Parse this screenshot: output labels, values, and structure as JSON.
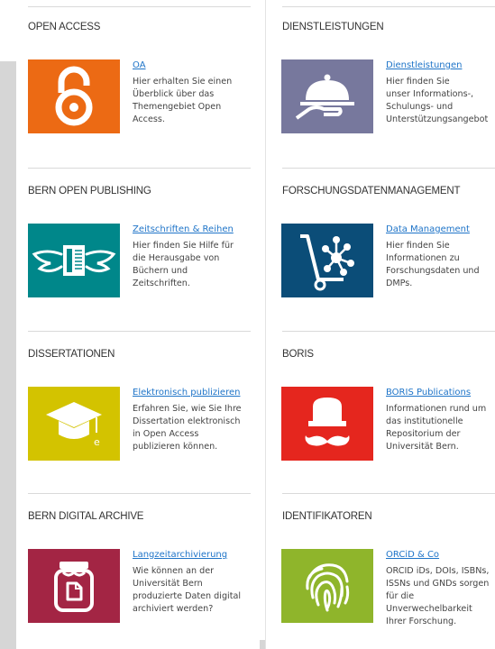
{
  "colors": {
    "oa": "#ec6a14",
    "dienstleistungen": "#77789d",
    "bop": "#00878a",
    "fdm": "#0b4d78",
    "dissertationen": "#d3c300",
    "boris": "#e5261e",
    "archive": "#a32544",
    "identifikatoren": "#8fb52b",
    "link": "#1e74c8"
  },
  "sections": {
    "open_access": {
      "title": "OPEN ACCESS",
      "icon": "open-lock-icon",
      "link": "OA",
      "desc": [
        "Hier erhalten Sie einen",
        "Überblick über das",
        "Themengebiet Open",
        "Access."
      ]
    },
    "dienstleistungen": {
      "title": "DIENSTLEISTUNGEN",
      "icon": "serving-tray-icon",
      "link": "Dienstleistungen",
      "desc": [
        "Hier finden Sie",
        "unser Informations-,",
        "Schulungs- und",
        "Unterstützungsangebot"
      ]
    },
    "bern_open_publishing": {
      "title": "BERN OPEN PUBLISHING",
      "icon": "winged-book-icon",
      "link": "Zeitschriften & Reihen",
      "desc": [
        "Hier finden Sie Hilfe für",
        "die Herausgabe von",
        "Büchern und",
        "Zeitschriften."
      ]
    },
    "forschungsdaten": {
      "title": "FORSCHUNGSDATENMANAGEMENT",
      "icon": "data-cart-icon",
      "link": "Data Management",
      "desc": [
        "Hier finden Sie",
        "Informationen zu",
        "Forschungsdaten und",
        "DMPs."
      ]
    },
    "dissertationen": {
      "title": "DISSERTATIONEN",
      "icon": "graduation-cap-icon",
      "link": "Elektronisch publizieren",
      "desc": [
        "Erfahren Sie, wie Sie Ihre",
        "Dissertation elektronisch",
        "in Open Access",
        "publizieren können."
      ]
    },
    "boris": {
      "title": "BORIS",
      "icon": "mustache-hat-icon",
      "link": "BORIS Publications",
      "desc": [
        "Informationen rund um",
        "das institutionelle",
        "Repositorium der",
        "Universität Bern."
      ]
    },
    "bern_digital_archive": {
      "title": "BERN DIGITAL ARCHIVE",
      "icon": "archive-jar-icon",
      "link": "Langzeitarchivierung",
      "desc": [
        "Wie können an der",
        "Universität Bern",
        "produzierte Daten digital",
        "archiviert werden?"
      ]
    },
    "identifikatoren": {
      "title": "IDENTIFIKATOREN",
      "icon": "fingerprint-icon",
      "link": "ORCiD & Co",
      "desc": [
        "ORCID iDs, DOIs, ISBNs,",
        "ISSNs und GNDs sorgen",
        "für die",
        "Unverwechelbarkeit",
        "Ihrer Forschung."
      ]
    }
  }
}
